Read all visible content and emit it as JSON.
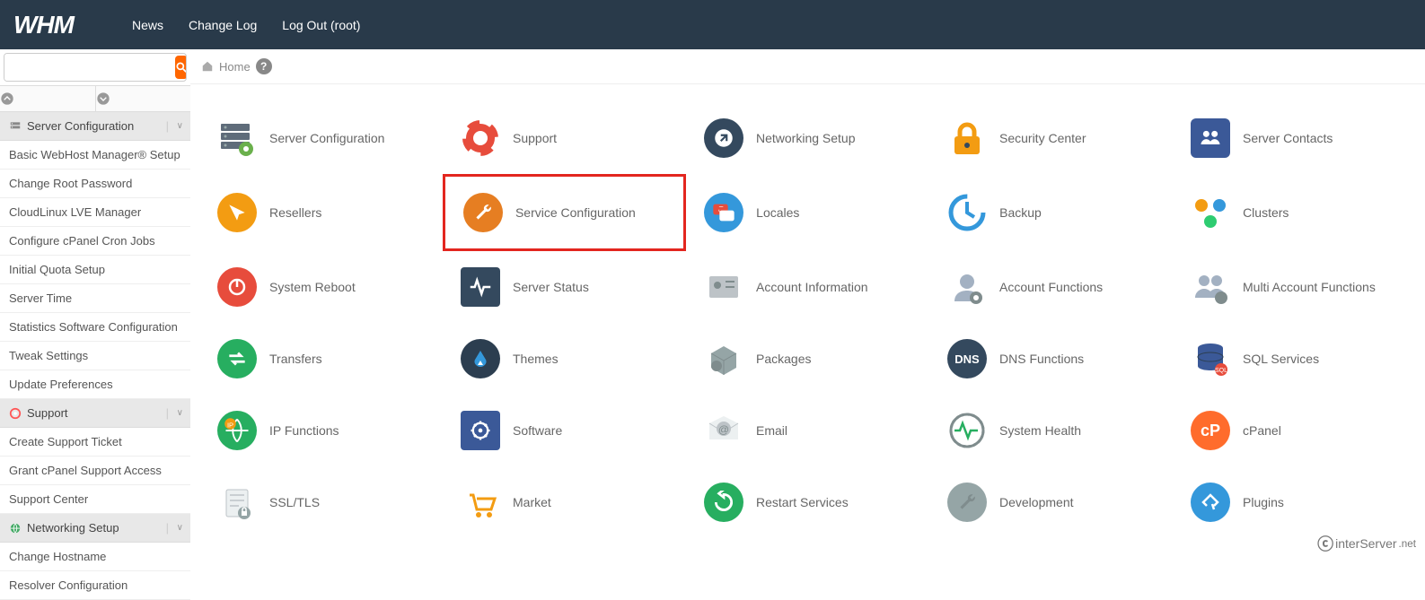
{
  "logo": "WHM",
  "topnav": {
    "news": "News",
    "changelog": "Change Log",
    "logout": "Log Out (root)"
  },
  "search": {
    "placeholder": ""
  },
  "breadcrumb": {
    "home": "Home"
  },
  "sidebar": {
    "sections": [
      {
        "title": "Server Configuration",
        "items": [
          "Basic WebHost Manager® Setup",
          "Change Root Password",
          "CloudLinux LVE Manager",
          "Configure cPanel Cron Jobs",
          "Initial Quota Setup",
          "Server Time",
          "Statistics Software Configuration",
          "Tweak Settings",
          "Update Preferences"
        ]
      },
      {
        "title": "Support",
        "items": [
          "Create Support Ticket",
          "Grant cPanel Support Access",
          "Support Center"
        ]
      },
      {
        "title": "Networking Setup",
        "items": [
          "Change Hostname",
          "Resolver Configuration"
        ]
      }
    ]
  },
  "grid": [
    [
      "Server Configuration",
      "Support",
      "Networking Setup",
      "Security Center",
      "Server Contacts"
    ],
    [
      "Resellers",
      "Service Configuration",
      "Locales",
      "Backup",
      "Clusters"
    ],
    [
      "System Reboot",
      "Server Status",
      "Account Information",
      "Account Functions",
      "Multi Account Functions"
    ],
    [
      "Transfers",
      "Themes",
      "Packages",
      "DNS Functions",
      "SQL Services"
    ],
    [
      "IP Functions",
      "Software",
      "Email",
      "System Health",
      "cPanel"
    ],
    [
      "SSL/TLS",
      "Market",
      "Restart Services",
      "Development",
      "Plugins"
    ]
  ],
  "highlighted": "Service Configuration",
  "footer": {
    "brand": "interServer",
    "suffix": ".net"
  }
}
